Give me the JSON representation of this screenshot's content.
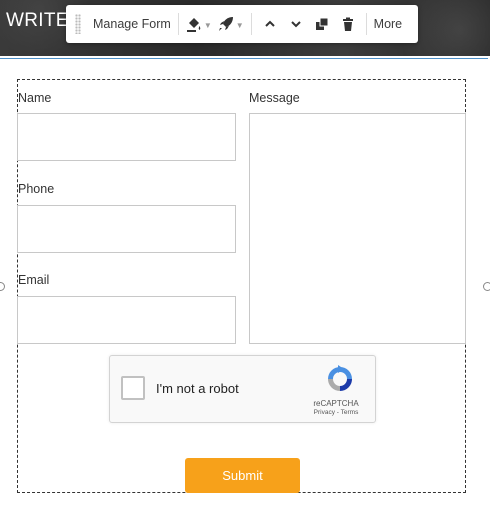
{
  "header": {
    "title": "WRITE"
  },
  "toolbar": {
    "manage_form": "Manage Form",
    "more": "More",
    "icons": [
      "drag-handle",
      "paint-bucket",
      "rocket",
      "chevron-up",
      "chevron-down",
      "duplicate",
      "trash"
    ]
  },
  "form": {
    "fields": {
      "name_label": "Name",
      "phone_label": "Phone",
      "email_label": "Email",
      "message_label": "Message"
    },
    "recaptcha": {
      "checkbox_label": "I'm not a robot",
      "brand": "reCAPTCHA",
      "links": "Privacy - Terms"
    },
    "submit_label": "Submit"
  },
  "colors": {
    "accent_submit": "#f7a11a",
    "selection_border": "#4d90c9",
    "recaptcha_blue": "#4a90e2",
    "header_bg": "#2b2b2b"
  }
}
